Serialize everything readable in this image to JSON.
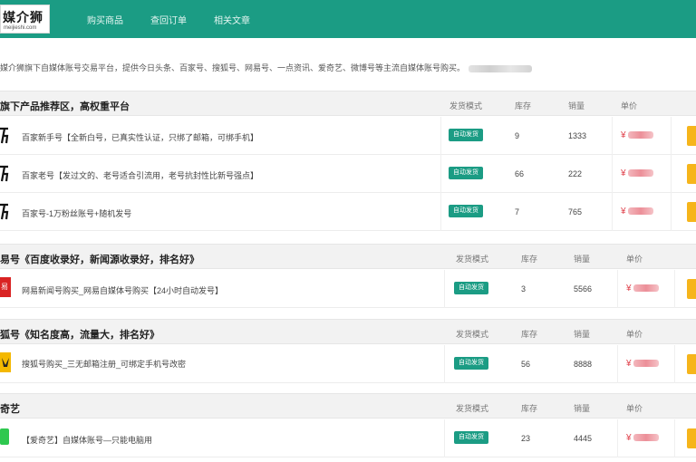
{
  "header": {
    "logo_text": "媒介狮",
    "logo_sub": "meijieshi.com",
    "nav": [
      "购买商品",
      "查回订单",
      "相关文章"
    ]
  },
  "intro": "媒介狮旗下自媒体账号交易平台，提供今日头条、百家号、搜狐号、网易号、一点资讯、爱奇艺、微博号等主流自媒体账号购买。",
  "sections": [
    {
      "title": "旗下产品推荐区，高权重平台",
      "cols": {
        "mode": "发货模式",
        "stock": "库存",
        "sales": "销量",
        "price": "单价"
      },
      "rows": [
        {
          "name": "百家新手号【全新白号，已真实性认证，只绑了邮箱，可绑手机】",
          "mode": "自动发货",
          "stock": "9",
          "sales": "1333",
          "price": "¥"
        },
        {
          "name": "百家老号【发过文的、老号适合引流用，老号抗封性比新号强点】",
          "mode": "自动发货",
          "stock": "66",
          "sales": "222",
          "price": "¥"
        },
        {
          "name": "百家号-1万粉丝账号+随机发号",
          "mode": "自动发货",
          "stock": "7",
          "sales": "765",
          "price": "¥"
        }
      ]
    },
    {
      "title": "易号《百度收录好，新闻源收录好，排名好》",
      "cols": {
        "mode": "发货模式",
        "stock": "库存",
        "sales": "销量",
        "price": "单价"
      },
      "rows": [
        {
          "name": "网易新闻号购买_网易自媒体号购买【24小时自动发号】",
          "mode": "自动发货",
          "stock": "3",
          "sales": "5566",
          "price": "¥"
        }
      ]
    },
    {
      "title": "狐号《知名度高，流量大，排名好》",
      "cols": {
        "mode": "发货模式",
        "stock": "库存",
        "sales": "销量",
        "price": "单价"
      },
      "rows": [
        {
          "name": "搜狐号购买_三无邮箱注册_可绑定手机号改密",
          "mode": "自动发货",
          "stock": "56",
          "sales": "8888",
          "price": "¥"
        }
      ]
    },
    {
      "title": "奇艺",
      "cols": {
        "mode": "发货模式",
        "stock": "库存",
        "sales": "销量",
        "price": "单价"
      },
      "rows": [
        {
          "name": "【爱奇艺】自媒体账号—只能电脑用",
          "mode": "自动发货",
          "stock": "23",
          "sales": "4445",
          "price": "¥"
        }
      ]
    }
  ]
}
